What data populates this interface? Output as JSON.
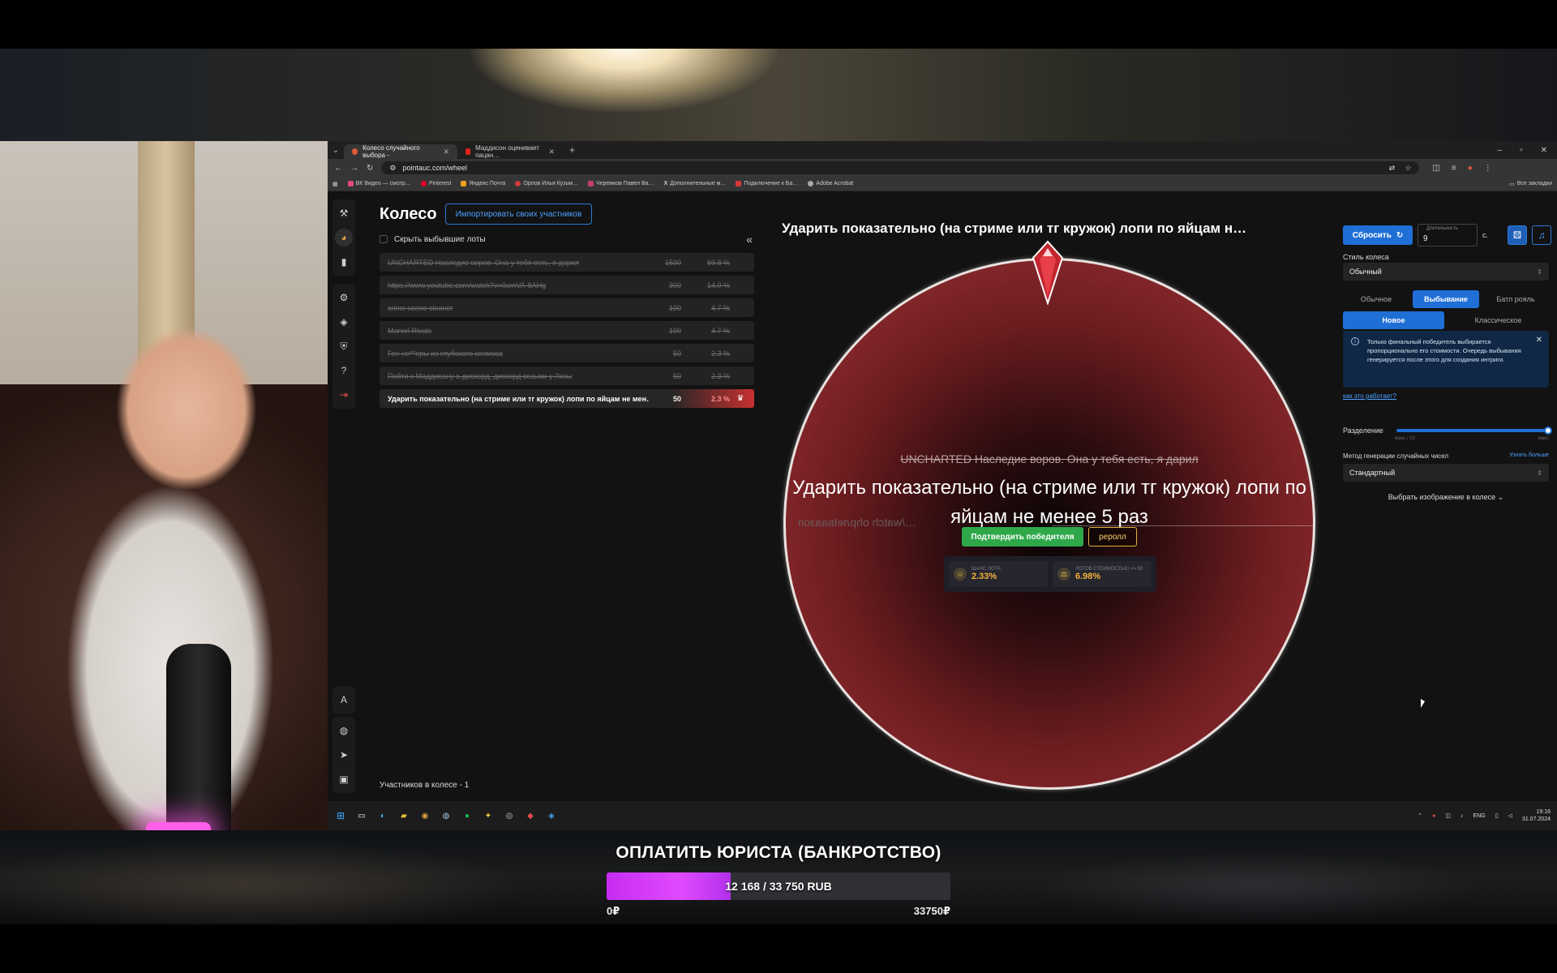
{
  "browser": {
    "tabs": [
      {
        "label": "Колесо случайного выбора -",
        "active": true,
        "favicon_color": "#e05a3a"
      },
      {
        "label": "Маддисон оценивает пацан…",
        "active": false,
        "favicon_color": "#e62117"
      }
    ],
    "url": "pointauc.com/wheel",
    "bookmarks": [
      {
        "label": "ВК Видео — смотр…",
        "color": "#e24c7a"
      },
      {
        "label": "Pinterest",
        "color": "#e60023"
      },
      {
        "label": "Яндекс Почта",
        "color": "#f2a11c"
      },
      {
        "label": "Орлов Илья Кузьм…",
        "color": "#cc3b3b"
      },
      {
        "label": "Черемков Павел Ва…",
        "color": "#c23f6e"
      },
      {
        "label": "Дополнительные м…",
        "color": "#ffffff"
      },
      {
        "label": "Подключение к Ба…",
        "color": "#d83a3a"
      },
      {
        "label": "Adobe Acrobat",
        "color": "#aaaaaa"
      }
    ],
    "bookmarks_right": "Все закладки"
  },
  "lots": {
    "title": "Колесо",
    "import_label": "Импортировать своих участников",
    "hide_label": "Скрыть выбывшие лоты",
    "items": [
      {
        "name": "UNCHARTED Наследие воров. Она у тебя есть, я дарил",
        "amount": "1500",
        "pct": "69.8 %"
      },
      {
        "name": "https://www.youtube.com/watch?v=0umVA-8AHg",
        "amount": "300",
        "pct": "14.0 %"
      },
      {
        "name": "crime scene cleaner",
        "amount": "100",
        "pct": "4.7 %"
      },
      {
        "name": "Marvel Rivals",
        "amount": "100",
        "pct": "4.7 %"
      },
      {
        "name": "Ген-не**еры из глубокого космоса",
        "amount": "50",
        "pct": "2.3 %"
      },
      {
        "name": "Пойти к Маддисону в дискорд, дискорд возьми у Лизы",
        "amount": "50",
        "pct": "2.3 %"
      }
    ],
    "active_item": {
      "name": "Ударить показательно (на стриме или тг кружок) лопи по яйцам не мен…",
      "amount": "50",
      "pct": "2.3 %"
    },
    "participants": "Участников в колесе - 1"
  },
  "wheel": {
    "title": "Ударить показательно (на стриме или тг кружок) лопи по яйцам н…",
    "previous_winner": "UNCHARTED Наследие воров. Она у тебя есть, я дарил",
    "winner": "Ударить показательно (на стриме или тг кружок) лопи по яйцам не менее 5 раз",
    "mirrored_text": "…/watch ohpлetваaзоп",
    "confirm_label": "Подтвердить победителя",
    "reroll_label": "реролл",
    "stats": [
      {
        "label": "шанс лота",
        "value": "2.33%",
        "icon": "☺"
      },
      {
        "label": "лотов стоимостью <= 50",
        "value": "6.98%",
        "icon": "⚖"
      }
    ],
    "fill_color": "#a5363a"
  },
  "settings": {
    "reset_label": "Сбросить",
    "duration_label": "Длительность",
    "duration_value": "9",
    "duration_unit": "с.",
    "style_label": "Стиль колеса",
    "style_value": "Обычный",
    "mode_tabs": [
      {
        "label": "Обычное",
        "active": false
      },
      {
        "label": "Выбывание",
        "active": true
      }
    ],
    "battle_label": "Батл рояль",
    "sub_tabs": [
      {
        "label": "Новое",
        "active": true
      },
      {
        "label": "Классическое",
        "active": false
      }
    ],
    "info_text": "Только финальный победитель выбирается пропорционально его стоимости. Очередь выбывания генерируется после этого для создания интриги.",
    "how_link": "как это работает?",
    "split_label": "Разделение",
    "split_min_label": "макс / 10",
    "split_max_label": "макс",
    "split_value": 1.0,
    "rng_label": "Метод генерации случайных чисел",
    "rng_link": "Узнать больше",
    "rng_value": "Стандартный",
    "image_select_label": "Выбрать изображение в колесе"
  },
  "taskbar": {
    "lang": "ENG",
    "time": "19:16",
    "date": "31.07.2024"
  },
  "goal": {
    "title": "ОПЛАТИТЬ ЮРИСТА (БАНКРОТСТВО)",
    "progress_text": "12 168 / 33 750 RUB",
    "current": 12168,
    "target": 33750,
    "min_label": "0₽",
    "max_label": "33750₽"
  }
}
